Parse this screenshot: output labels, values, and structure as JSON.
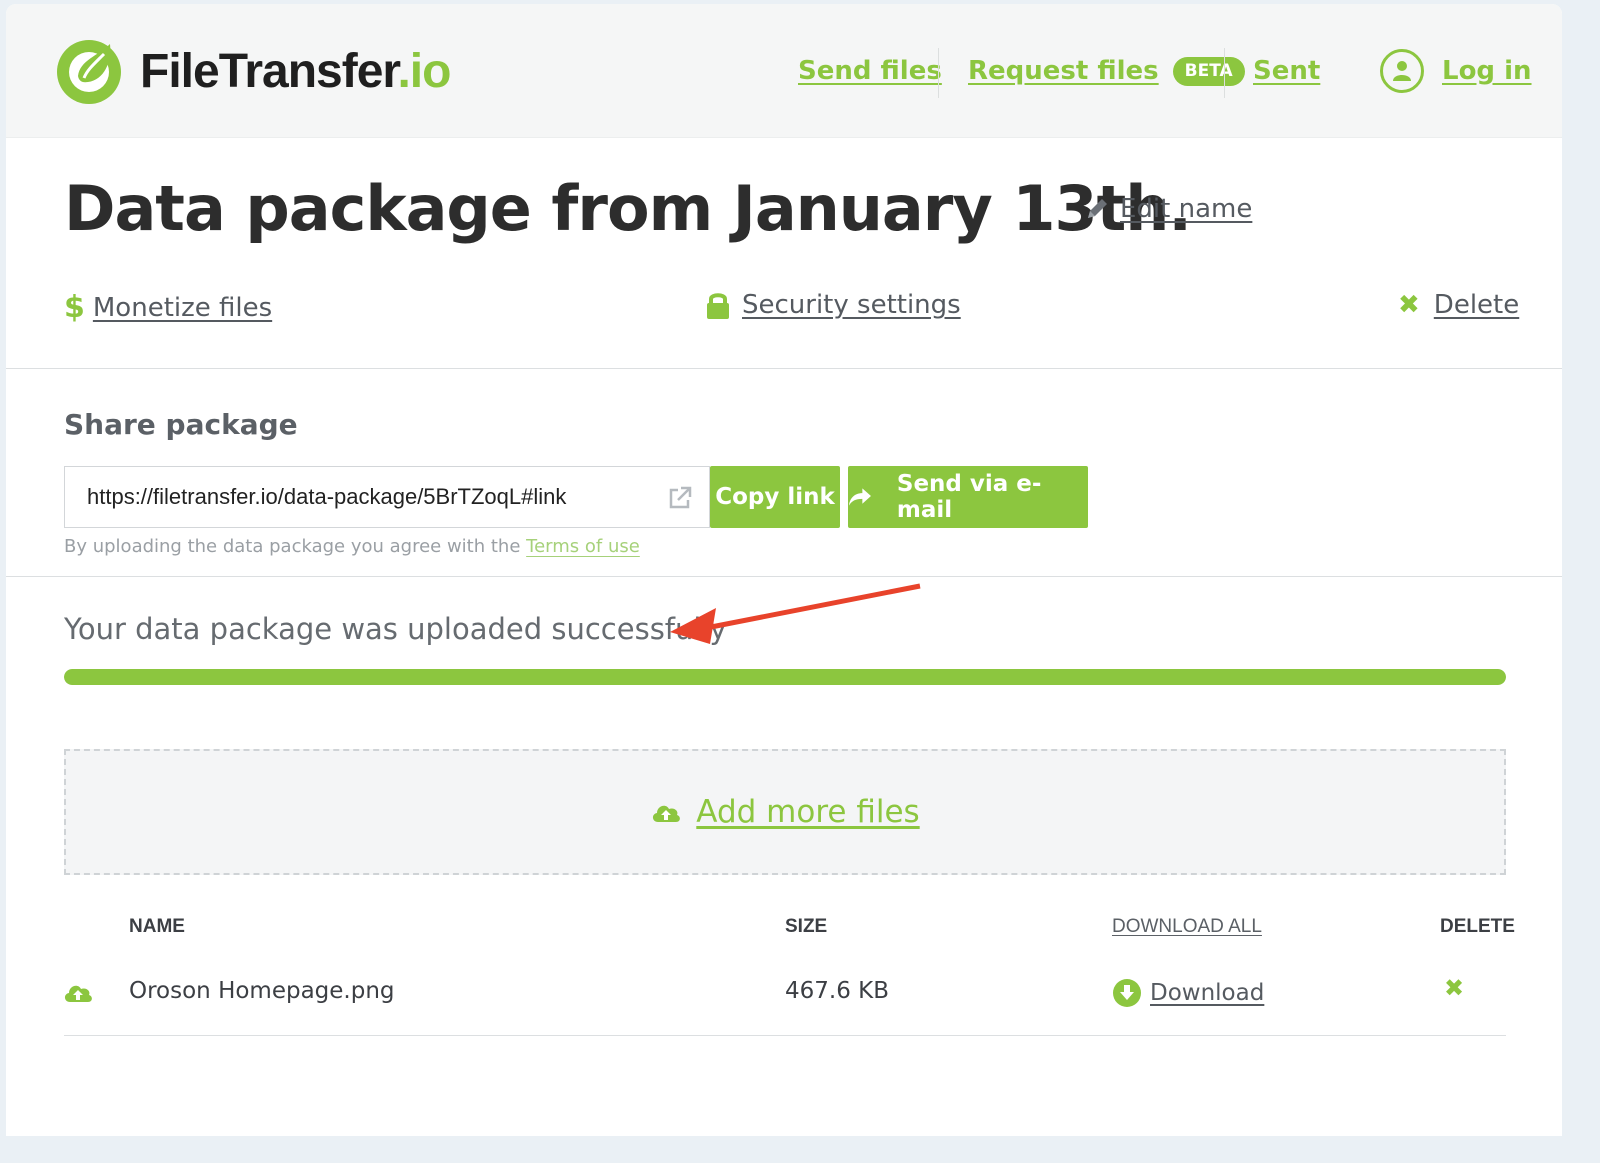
{
  "header": {
    "logo_main": "FileTransfer",
    "logo_tld": ".io",
    "nav": {
      "send_files": "Send files",
      "request_files": "Request files",
      "beta_badge": "BETA",
      "sent": "Sent",
      "login": "Log in"
    }
  },
  "package": {
    "title": "Data package from January 13th.",
    "edit_name": "Edit name",
    "monetize": "Monetize files",
    "security": "Security settings",
    "delete": "Delete"
  },
  "share": {
    "heading": "Share package",
    "url": "https://filetransfer.io/data-package/5BrTZoqL#link",
    "copy_link": "Copy link",
    "send_email": "Send via e-mail",
    "terms_prefix": "By uploading the data package you agree with the",
    "terms_link": "Terms of use"
  },
  "upload": {
    "status": "Your data package was uploaded successfully",
    "progress": 1.0,
    "add_more": "Add more files"
  },
  "table": {
    "headers": {
      "name": "NAME",
      "size": "SIZE",
      "download_all": "DOWNLOAD ALL",
      "delete": "DELETE"
    },
    "rows": [
      {
        "name": "Oroson Homepage.png",
        "size": "467.6 KB",
        "download": "Download"
      }
    ]
  },
  "colors": {
    "accent": "#8cc63f",
    "annotation_arrow": "#e8432b"
  }
}
